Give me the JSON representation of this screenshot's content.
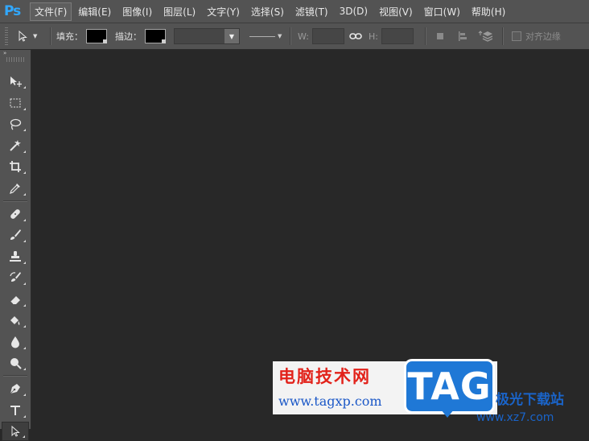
{
  "app": {
    "logo": "Ps"
  },
  "menu": [
    "文件(F)",
    "编辑(E)",
    "图像(I)",
    "图层(L)",
    "文字(Y)",
    "选择(S)",
    "滤镜(T)",
    "3D(D)",
    "视图(V)",
    "窗口(W)",
    "帮助(H)"
  ],
  "options": {
    "fill_label": "填充：",
    "stroke_label": "描边：",
    "w_label": "W:",
    "h_label": "H:",
    "align_edges_label": "对齐边缘"
  },
  "tools": [
    "move-tool",
    "marquee-tool",
    "lasso-tool",
    "magic-wand-tool",
    "crop-tool",
    "eyedropper-tool",
    "healing-brush-tool",
    "brush-tool",
    "clone-stamp-tool",
    "history-brush-tool",
    "eraser-tool",
    "paint-bucket-tool",
    "blur-tool",
    "dodge-tool",
    "pen-tool",
    "type-tool",
    "path-selection-tool"
  ],
  "watermark": {
    "title": "电脑技术网",
    "url": "www.tagxp.com",
    "badge": "TAG",
    "site_name": "极光下载站",
    "site_url": "www.xz7.com"
  }
}
